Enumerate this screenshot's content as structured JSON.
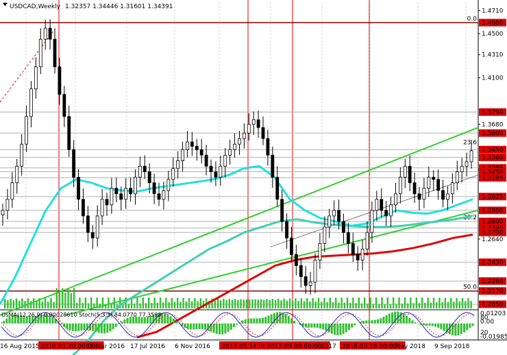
{
  "header": {
    "symbol": "USDCAD,Weekly",
    "ohlc": "1.32357 1.34446 1.31601 1.34391"
  },
  "colors": {
    "bull": "#000000",
    "bear": "#000000",
    "grid": "#c8c8c8",
    "ema_fast": "#20e0e0",
    "ema_mid": "#40d0b0",
    "ema_slow": "#e00000",
    "channel": "#30d030",
    "level_line": "#800000",
    "level_tag": "#e00000",
    "volume": "#30c030"
  },
  "price_axis": {
    "ticks": [
      "1.4710",
      "1.4500",
      "1.4310",
      "1.4100",
      "1.3900",
      "1.3680",
      "1.3480",
      "1.3270",
      "1.3060",
      "1.2850",
      "1.2640",
      "1.2440",
      "1.2230"
    ],
    "visible_ticks": [
      "1.4710",
      "1.4500",
      "1.4310",
      "1.4100",
      "1.3680",
      "1.3270",
      "1.2640"
    ],
    "level_tags": [
      "1.4600",
      "1.3790",
      "1.3600",
      "1.3450",
      "1.3380",
      "1.3285",
      "1.3250",
      "1.3195",
      "1.3025",
      "1.2900",
      "1.2800",
      "1.2740",
      "1.2700",
      "1.2430",
      "1.2260",
      "1.2170",
      "1.2050"
    ],
    "fib_labels": [
      "0.0",
      "23.6",
      "38.2",
      "50.0"
    ]
  },
  "oscillator": {
    "label": "OsMA(12,26,9) 0.00028610  Stoch(5,3,3) 84.0770 77.3598",
    "right_ticks": [
      "0.01203",
      "0.00",
      "-0.01985"
    ],
    "stoch_ticks": [
      "80",
      "20"
    ]
  },
  "time_axis": {
    "labels": [
      "16 Aug 2015",
      "2016.01.20 00:00",
      "27 Mar 2016",
      "17 Jul 2016",
      "6 Nov 2016",
      "2017.05.14 00:00",
      "2017.09.08 00:00",
      "2017",
      "2018.03.18 00:00",
      "0 May 2018",
      "9 Sep 2018"
    ]
  },
  "chart_data": {
    "type": "candlestick",
    "title": "USDCAD,Weekly",
    "ylim": [
      1.2,
      1.478
    ],
    "horizontal_levels": [
      1.46,
      1.379,
      1.36,
      1.345,
      1.338,
      1.3285,
      1.325,
      1.3195,
      1.3025,
      1.29,
      1.28,
      1.274,
      1.27,
      1.243,
      1.226,
      1.217,
      1.205
    ],
    "vertical_markers": [
      "2016.01.20 00:00",
      "2017.05.14 00:00",
      "2017.09.08 00:00",
      "2018.03.18 00:00"
    ],
    "close_path": [
      1.29,
      1.3,
      1.315,
      1.33,
      1.35,
      1.375,
      1.4,
      1.42,
      1.445,
      1.455,
      1.445,
      1.42,
      1.395,
      1.375,
      1.345,
      1.32,
      1.3,
      1.285,
      1.27,
      1.265,
      1.285,
      1.3,
      1.295,
      1.31,
      1.305,
      1.3,
      1.31,
      1.305,
      1.32,
      1.33,
      1.325,
      1.315,
      1.305,
      1.3,
      1.308,
      1.318,
      1.328,
      1.335,
      1.345,
      1.352,
      1.348,
      1.345,
      1.34,
      1.33,
      1.325,
      1.32,
      1.33,
      1.34,
      1.345,
      1.35,
      1.355,
      1.36,
      1.368,
      1.372,
      1.365,
      1.355,
      1.34,
      1.32,
      1.3,
      1.28,
      1.265,
      1.25,
      1.24,
      1.23,
      1.222,
      1.225,
      1.245,
      1.26,
      1.275,
      1.285,
      1.29,
      1.28,
      1.27,
      1.26,
      1.25,
      1.245,
      1.255,
      1.27,
      1.29,
      1.3,
      1.29,
      1.285,
      1.295,
      1.305,
      1.32,
      1.33,
      1.315,
      1.305,
      1.3,
      1.31,
      1.32,
      1.318,
      1.308,
      1.3,
      1.305,
      1.315,
      1.325,
      1.33,
      1.334,
      1.344
    ],
    "ema_fast_path": [
      1.205,
      1.23,
      1.26,
      1.29,
      1.31,
      1.318,
      1.315,
      1.31,
      1.308,
      1.307,
      1.31,
      1.312,
      1.314,
      1.316,
      1.318,
      1.322,
      1.328,
      1.33,
      1.32,
      1.3,
      1.29,
      1.283,
      1.28,
      1.276,
      1.278,
      1.284,
      1.29,
      1.288,
      1.287,
      1.29,
      1.295,
      1.3
    ],
    "ema_mid_path": [
      1.155,
      1.17,
      1.19,
      1.205,
      1.215,
      1.225,
      1.235,
      1.245,
      1.255,
      1.262,
      1.27,
      1.275,
      1.28,
      1.282,
      1.279,
      1.277,
      1.276,
      1.275,
      1.275,
      1.276,
      1.278,
      1.28,
      1.282,
      1.285
    ],
    "ema_slow_path": [
      1.175,
      1.18,
      1.19,
      1.2,
      1.21,
      1.22,
      1.23,
      1.24,
      1.245,
      1.248,
      1.249,
      1.25,
      1.251,
      1.253,
      1.256,
      1.26,
      1.265,
      1.268
    ],
    "fibonacci": {
      "0.0": 1.46,
      "23.6": 1.348,
      "38.2": 1.28,
      "50.0": 1.217
    },
    "x": [],
    "xlabel": "",
    "ylabel": ""
  }
}
